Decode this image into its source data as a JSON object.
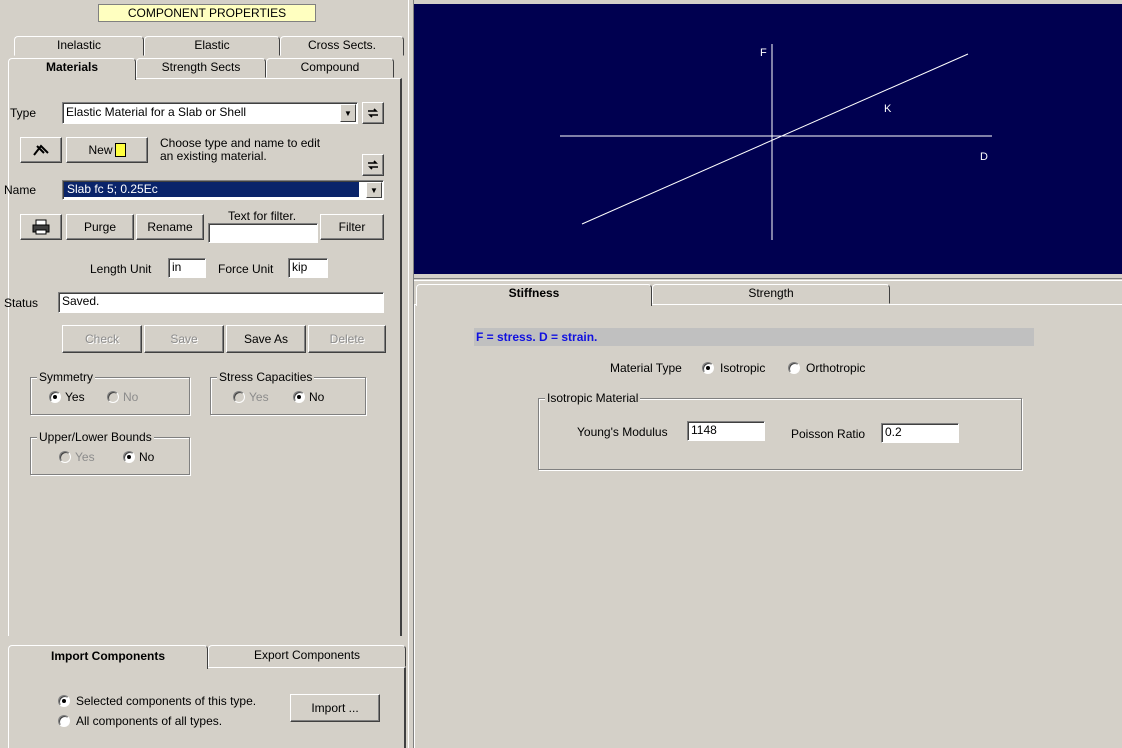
{
  "left": {
    "header_title": "COMPONENT PROPERTIES",
    "tabs_row1": [
      "Inelastic",
      "Elastic",
      "Cross Sects."
    ],
    "tabs_row2": [
      "Materials",
      "Strength Sects",
      "Compound"
    ],
    "type_label": "Type",
    "type_value": "Elastic Material for a Slab or Shell",
    "new_button": "New",
    "hint": "Choose type and name to edit an existing material.",
    "name_label": "Name",
    "name_value": "Slab fc 5; 0.25Ec",
    "purge_button": "Purge",
    "rename_button": "Rename",
    "filter_label": "Text for filter.",
    "filter_value": "",
    "filter_button": "Filter",
    "length_unit_label": "Length Unit",
    "length_unit_value": "in",
    "force_unit_label": "Force Unit",
    "force_unit_value": "kip",
    "status_label": "Status",
    "status_value": "Saved.",
    "check_button": "Check",
    "save_button": "Save",
    "save_as_button": "Save As",
    "delete_button": "Delete",
    "symmetry": {
      "title": "Symmetry",
      "yes": "Yes",
      "no": "No"
    },
    "stress_capacities": {
      "title": "Stress Capacities",
      "yes": "Yes",
      "no": "No"
    },
    "bounds": {
      "title": "Upper/Lower Bounds",
      "yes": "Yes",
      "no": "No"
    }
  },
  "bottom_left": {
    "tabs": [
      "Import Components",
      "Export Components"
    ],
    "opt_selected": "Selected components of this type.",
    "opt_all": "All components of all types.",
    "import_button": "Import ..."
  },
  "graph": {
    "label_f": "F",
    "label_k": "K",
    "label_d": "D",
    "bg_color": "#000050"
  },
  "right": {
    "tabs": [
      "Stiffness",
      "Strength"
    ],
    "banner": "F = stress.  D = strain.",
    "material_type_label": "Material Type",
    "isotropic": "Isotropic",
    "orthotropic": "Orthotropic",
    "iso_group_title": "Isotropic Material",
    "youngs_label": "Young's Modulus",
    "youngs_value": "1148",
    "poisson_label": "Poisson Ratio",
    "poisson_value": "0.2"
  }
}
